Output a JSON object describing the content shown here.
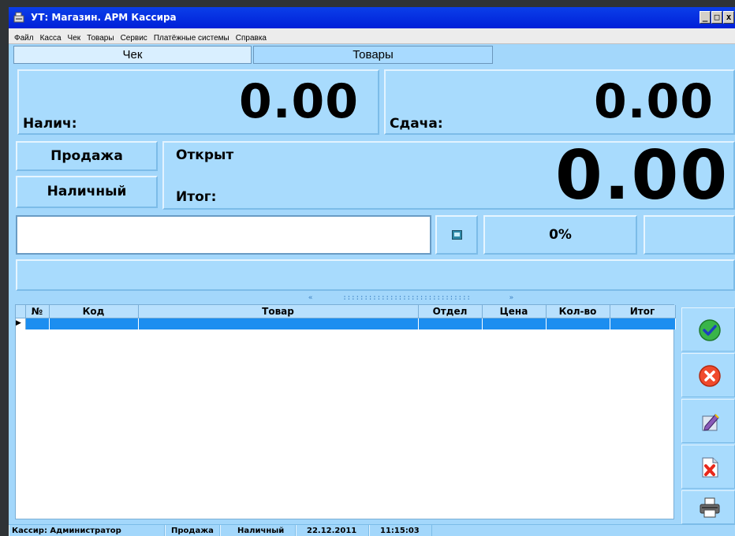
{
  "window": {
    "title": "УТ: Магазин. АРМ Кассира",
    "minimize": "_",
    "maximize": "□",
    "close": "x"
  },
  "menu": [
    "Файл",
    "Касса",
    "Чек",
    "Товары",
    "Сервис",
    "Платёжные системы",
    "Справка"
  ],
  "tabs": [
    {
      "label": "Чек",
      "active": true
    },
    {
      "label": "Товары",
      "active": false
    }
  ],
  "cash": {
    "label": "Налич:",
    "value": "0.00"
  },
  "change": {
    "label": "Сдача:",
    "value": "0.00"
  },
  "mode_buttons": {
    "sale": "Продажа",
    "payment": "Наличный"
  },
  "receipt": {
    "status": "Открыт",
    "total_label": "Итог:",
    "total_value": "0.00"
  },
  "entry": {
    "input_value": "",
    "discount": "0%",
    "extra": ""
  },
  "grid": {
    "columns": [
      "№",
      "Код",
      "Товар",
      "Отдел",
      "Цена",
      "Кол-во",
      "Итог"
    ],
    "rows": [
      [
        "",
        "",
        "",
        "",
        "",
        "",
        ""
      ]
    ]
  },
  "side_buttons": [
    {
      "icon": "checkmark-icon"
    },
    {
      "icon": "cancel-icon"
    },
    {
      "icon": "edit-icon"
    },
    {
      "icon": "delete-document-icon"
    },
    {
      "icon": "printer-icon"
    }
  ],
  "status": {
    "cashier": "Кассир: Администратор",
    "operation": "Продажа",
    "payment": "Наличный",
    "date": "22.12.2011",
    "time": "11:15:03"
  },
  "colors": {
    "titlebar": "#0b3fe9",
    "panel": "#a8dbfd",
    "selected_row": "#1c8ef0"
  }
}
